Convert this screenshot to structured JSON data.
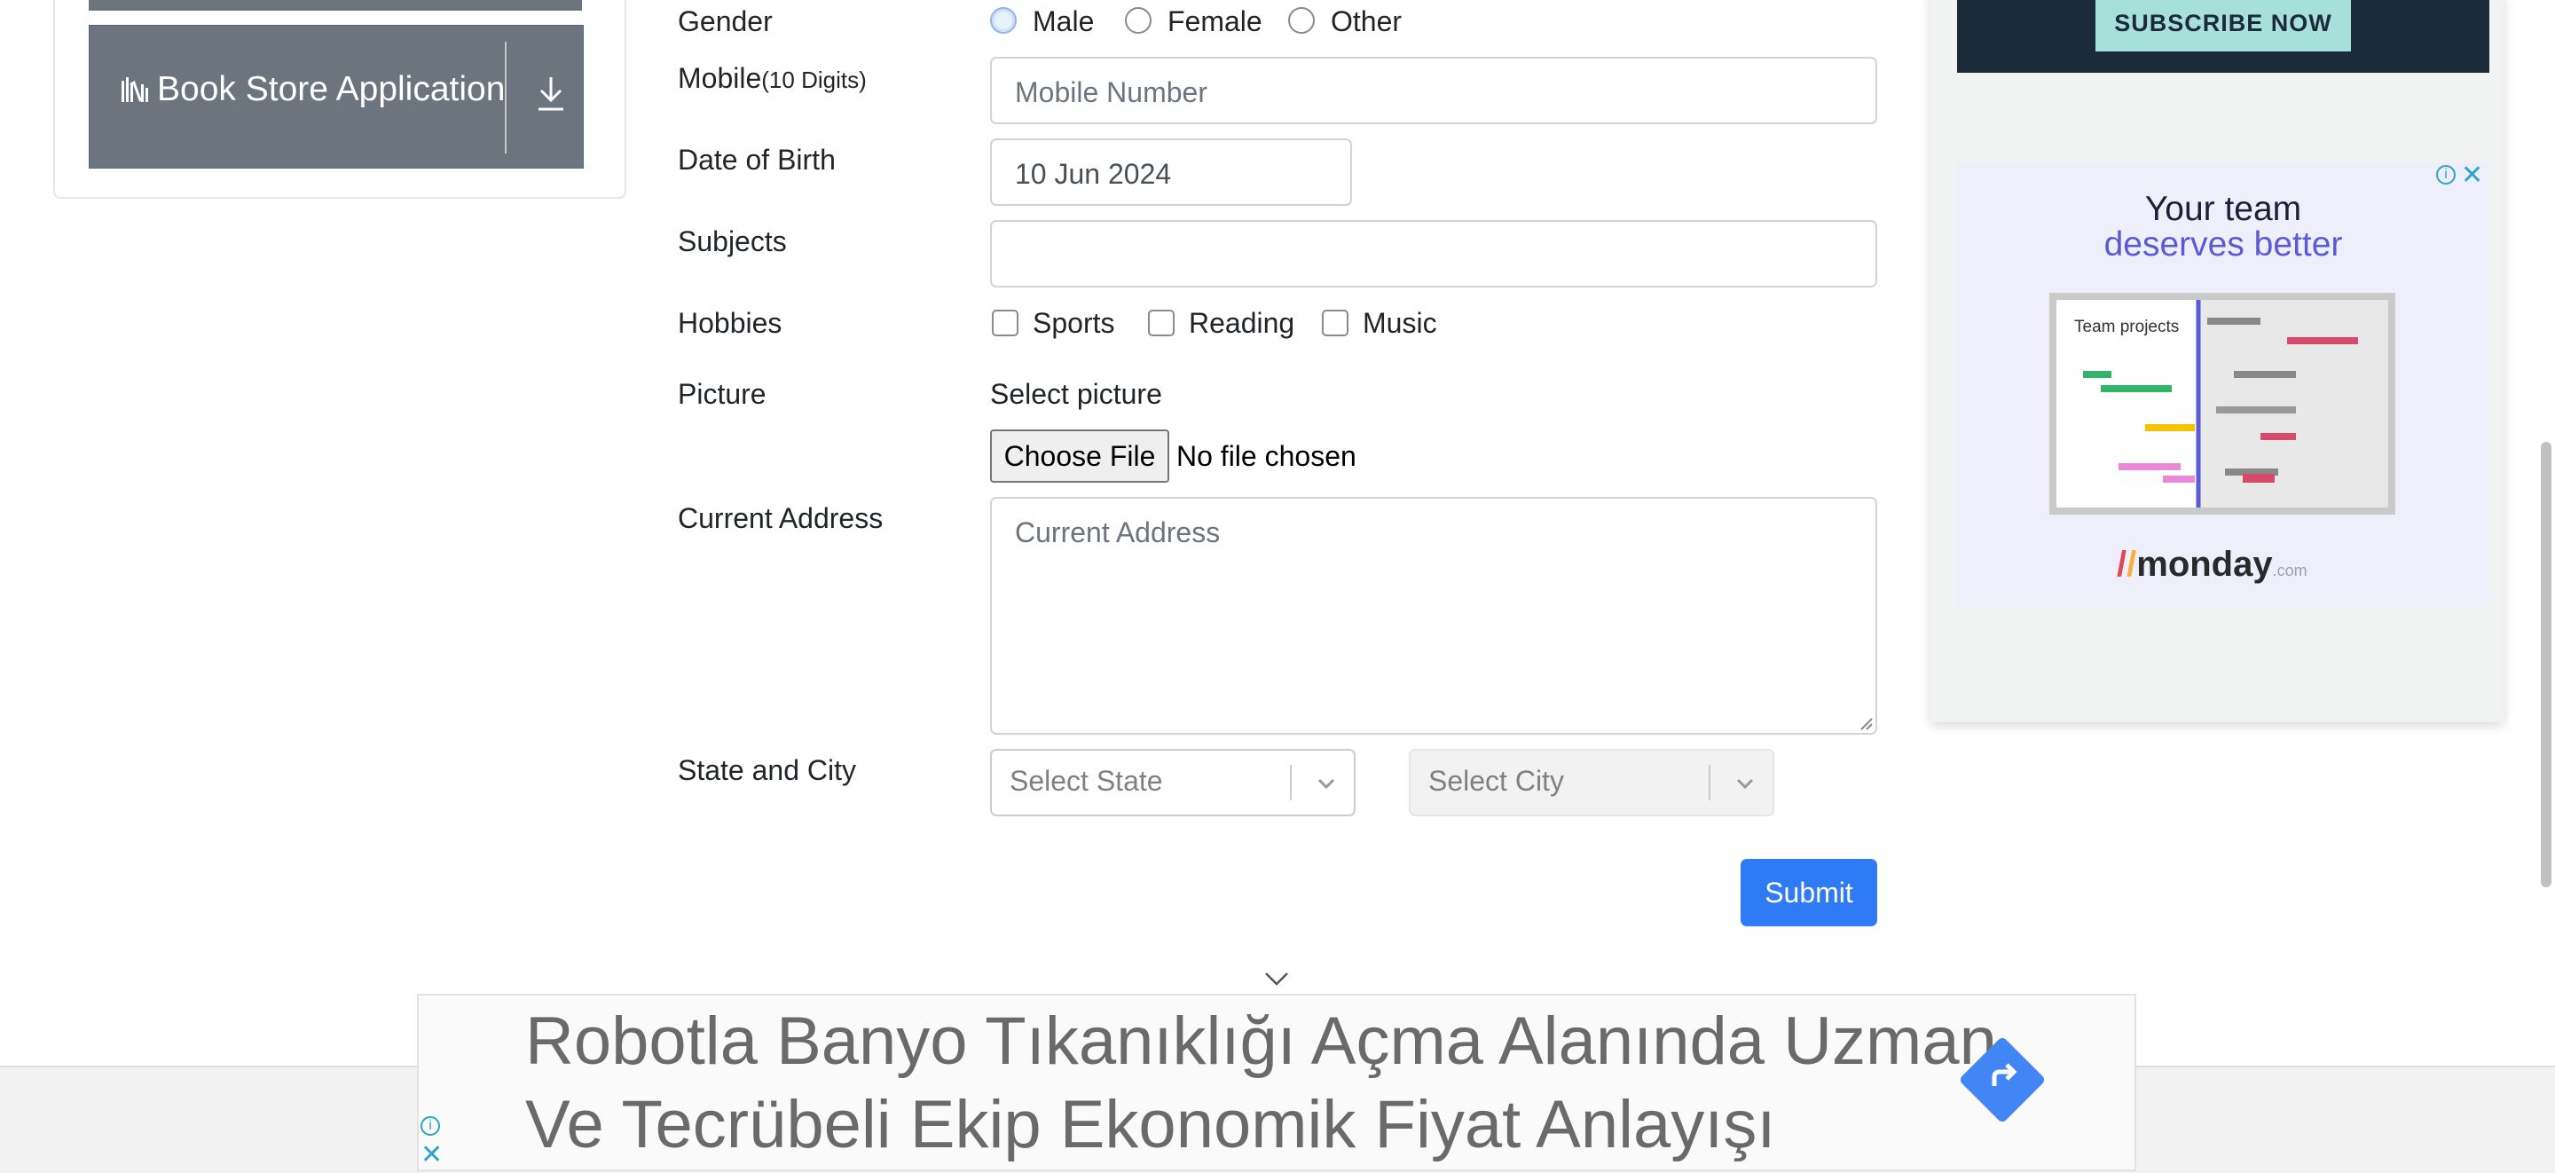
{
  "sidebar": {
    "book_store_label": "Book Store Application"
  },
  "form": {
    "gender": {
      "label": "Gender",
      "options": [
        "Male",
        "Female",
        "Other"
      ],
      "selected": "Male"
    },
    "mobile": {
      "label": "Mobile",
      "hint": "(10 Digits)",
      "placeholder": "Mobile Number",
      "value": ""
    },
    "dob": {
      "label": "Date of Birth",
      "value": "10 Jun 2024"
    },
    "subjects": {
      "label": "Subjects",
      "value": ""
    },
    "hobbies": {
      "label": "Hobbies",
      "options": [
        "Sports",
        "Reading",
        "Music"
      ]
    },
    "picture": {
      "label": "Picture",
      "select_text": "Select picture",
      "button": "Choose File",
      "status": "No file chosen"
    },
    "address": {
      "label": "Current Address",
      "placeholder": "Current Address"
    },
    "state_city": {
      "label": "State and City",
      "state_placeholder": "Select State",
      "city_placeholder": "Select City"
    },
    "submit": "Submit"
  },
  "ads": {
    "subscribe": "SUBSCRIBE NOW",
    "monday_line1": "Your team",
    "monday_line2": "deserves better",
    "monday_mock_label": "Team projects",
    "monday_logo": "monday",
    "monday_logo_suffix": ".com",
    "banner_line1": "Robotla Banyo Tıkanıklığı Açma Alanında Uzman",
    "banner_line2": "Ve Tecrübeli Ekip Ekonomik Fiyat Anlayışı",
    "info_glyph": "i",
    "close_glyph": "✕"
  },
  "colors": {
    "accent": "#2f7bf5",
    "sidebar_button": "#6c757d",
    "ad_dark": "#1c2b3a"
  }
}
